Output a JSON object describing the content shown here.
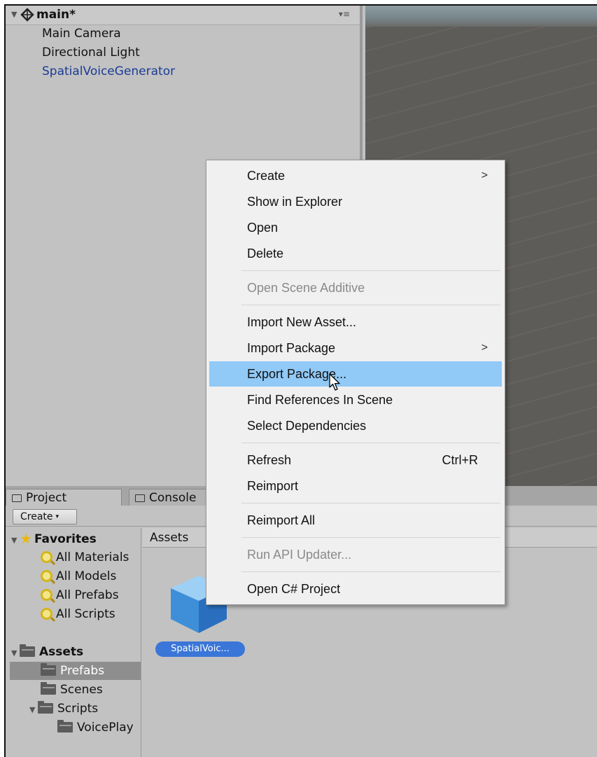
{
  "hierarchy": {
    "scene_title": "main*",
    "items": [
      "Main Camera",
      "Directional Light",
      "SpatialVoiceGenerator"
    ]
  },
  "tabs": {
    "project": "Project",
    "console": "Console"
  },
  "toolbar": {
    "create_label": "Create"
  },
  "tree": {
    "favorites_label": "Favorites",
    "favorites": [
      "All Materials",
      "All Models",
      "All Prefabs",
      "All Scripts"
    ],
    "assets_label": "Assets",
    "folders": [
      "Prefabs",
      "Scenes",
      "Scripts",
      "VoicePlay"
    ]
  },
  "assets_header": "Assets",
  "asset_item_label": "SpatialVoic...",
  "context_menu": {
    "create": "Create",
    "show_in_explorer": "Show in Explorer",
    "open": "Open",
    "delete": "Delete",
    "open_scene_additive": "Open Scene Additive",
    "import_new_asset": "Import New Asset...",
    "import_package": "Import Package",
    "export_package": "Export Package...",
    "find_references": "Find References In Scene",
    "select_dependencies": "Select Dependencies",
    "refresh": "Refresh",
    "refresh_shortcut": "Ctrl+R",
    "reimport": "Reimport",
    "reimport_all": "Reimport All",
    "run_api_updater": "Run API Updater...",
    "open_csharp_project": "Open C# Project",
    "submenu_arrow": ">"
  },
  "icons": {
    "fold_open": "▼",
    "menu_icon": "▾≡",
    "dropdown_arrow": "▾",
    "star": "★"
  },
  "colors": {
    "menu_highlight": "#91c9f7",
    "selected_asset": "#3a76d8",
    "hierarchy_link": "#1b3c95"
  }
}
